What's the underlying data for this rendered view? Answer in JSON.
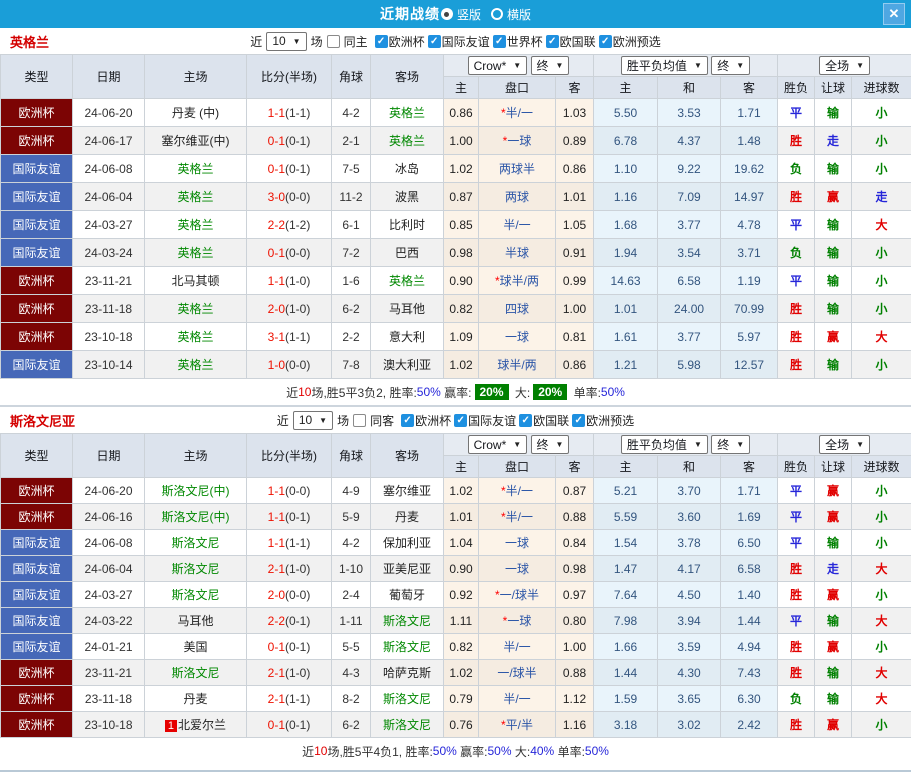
{
  "titlebar": {
    "title": "近期战绩",
    "vertical_label": "竖版",
    "horizontal_label": "横版",
    "close_glyph": "✕"
  },
  "colors": {
    "titlebar_blue": "#1a9ed8",
    "euro_cup_red": "#7c0404",
    "friendly_blue": "#4668b8",
    "featured_team_green": "#008800",
    "score_red": "#ee1100",
    "win_red": "#e10000",
    "draw_blue": "#2626d9",
    "lose_green": "#008000",
    "summary_badge_green": "#008000",
    "header_bg": "#dce3ed"
  },
  "header": {
    "cols": [
      "类型",
      "日期",
      "主场",
      "比分(半场)",
      "角球",
      "客场"
    ],
    "sub": [
      "主",
      "盘口",
      "客",
      "主",
      "和",
      "客",
      "胜负",
      "让球",
      "进球数"
    ],
    "company_select": "Crow*",
    "final_select_1": "终",
    "avg_select": "胜平负均值",
    "final_select_2": "终",
    "scope_select": "全场"
  },
  "sections": [
    {
      "team": "英格兰",
      "filter": {
        "near_label": "近",
        "count": "10",
        "games_label": "场",
        "same_label": "同主",
        "leagues": [
          "欧洲杯",
          "国际友谊",
          "世界杯",
          "欧国联",
          "欧洲预选"
        ]
      },
      "rows": [
        {
          "type": "欧洲杯",
          "date": "24-06-20",
          "home": "丹麦 (中)",
          "feat": "a",
          "badge": "",
          "score": "1-1",
          "half": "(1-1)",
          "corner": "4-2",
          "away": "英格兰",
          "hh": "0.86",
          "star": "*",
          "hname": "半/一",
          "ha": "1.03",
          "eh": "5.50",
          "ed": "3.53",
          "ea": "1.71",
          "res": "平",
          "letr": "输",
          "big": "小"
        },
        {
          "type": "欧洲杯",
          "date": "24-06-17",
          "home": "塞尔维亚(中)",
          "feat": "a",
          "badge": "",
          "score": "0-1",
          "half": "(0-1)",
          "corner": "2-1",
          "away": "英格兰",
          "hh": "1.00",
          "star": "*",
          "hname": "一球",
          "ha": "0.89",
          "eh": "6.78",
          "ed": "4.37",
          "ea": "1.48",
          "res": "胜",
          "letr": "走",
          "big": "小"
        },
        {
          "type": "国际友谊",
          "date": "24-06-08",
          "home": "英格兰",
          "feat": "h",
          "badge": "",
          "score": "0-1",
          "half": "(0-1)",
          "corner": "7-5",
          "away": "冰岛",
          "hh": "1.02",
          "star": "",
          "hname": "两球半",
          "ha": "0.86",
          "eh": "1.10",
          "ed": "9.22",
          "ea": "19.62",
          "res": "负",
          "letr": "输",
          "big": "小"
        },
        {
          "type": "国际友谊",
          "date": "24-06-04",
          "home": "英格兰",
          "feat": "h",
          "badge": "",
          "score": "3-0",
          "half": "(0-0)",
          "corner": "11-2",
          "away": "波黑",
          "hh": "0.87",
          "star": "",
          "hname": "两球",
          "ha": "1.01",
          "eh": "1.16",
          "ed": "7.09",
          "ea": "14.97",
          "res": "胜",
          "letr": "赢",
          "big": "走"
        },
        {
          "type": "国际友谊",
          "date": "24-03-27",
          "home": "英格兰",
          "feat": "h",
          "badge": "",
          "score": "2-2",
          "half": "(1-2)",
          "corner": "6-1",
          "away": "比利时",
          "hh": "0.85",
          "star": "",
          "hname": "半/一",
          "ha": "1.05",
          "eh": "1.68",
          "ed": "3.77",
          "ea": "4.78",
          "res": "平",
          "letr": "输",
          "big": "大"
        },
        {
          "type": "国际友谊",
          "date": "24-03-24",
          "home": "英格兰",
          "feat": "h",
          "badge": "",
          "score": "0-1",
          "half": "(0-0)",
          "corner": "7-2",
          "away": "巴西",
          "hh": "0.98",
          "star": "",
          "hname": "半球",
          "ha": "0.91",
          "eh": "1.94",
          "ed": "3.54",
          "ea": "3.71",
          "res": "负",
          "letr": "输",
          "big": "小"
        },
        {
          "type": "欧洲杯",
          "date": "23-11-21",
          "home": "北马其顿",
          "feat": "a",
          "badge": "",
          "score": "1-1",
          "half": "(1-0)",
          "corner": "1-6",
          "away": "英格兰",
          "hh": "0.90",
          "star": "*",
          "hname": "球半/两",
          "ha": "0.99",
          "eh": "14.63",
          "ed": "6.58",
          "ea": "1.19",
          "res": "平",
          "letr": "输",
          "big": "小"
        },
        {
          "type": "欧洲杯",
          "date": "23-11-18",
          "home": "英格兰",
          "feat": "h",
          "badge": "",
          "score": "2-0",
          "half": "(1-0)",
          "corner": "6-2",
          "away": "马耳他",
          "hh": "0.82",
          "star": "",
          "hname": "四球",
          "ha": "1.00",
          "eh": "1.01",
          "ed": "24.00",
          "ea": "70.99",
          "res": "胜",
          "letr": "输",
          "big": "小"
        },
        {
          "type": "欧洲杯",
          "date": "23-10-18",
          "home": "英格兰",
          "feat": "h",
          "badge": "",
          "score": "3-1",
          "half": "(1-1)",
          "corner": "2-2",
          "away": "意大利",
          "hh": "1.09",
          "star": "",
          "hname": "一球",
          "ha": "0.81",
          "eh": "1.61",
          "ed": "3.77",
          "ea": "5.97",
          "res": "胜",
          "letr": "赢",
          "big": "大"
        },
        {
          "type": "国际友谊",
          "date": "23-10-14",
          "home": "英格兰",
          "feat": "h",
          "badge": "",
          "score": "1-0",
          "half": "(0-0)",
          "corner": "7-8",
          "away": "澳大利亚",
          "hh": "1.02",
          "star": "",
          "hname": "球半/两",
          "ha": "0.86",
          "eh": "1.21",
          "ed": "5.98",
          "ea": "12.57",
          "res": "胜",
          "letr": "输",
          "big": "小"
        }
      ],
      "summary": {
        "parts": [
          {
            "t": "近",
            "c": ""
          },
          {
            "t": "10",
            "c": "red"
          },
          {
            "t": "场,胜5平3负2, 胜率:",
            "c": ""
          },
          {
            "t": "50%",
            "c": "blue"
          },
          {
            "t": " 赢率:",
            "c": ""
          },
          {
            "t": "20%",
            "c": "badge"
          },
          {
            "t": " 大:",
            "c": ""
          },
          {
            "t": "20%",
            "c": "badge"
          },
          {
            "t": " 单率:",
            "c": ""
          },
          {
            "t": "50%",
            "c": "blue"
          }
        ]
      }
    },
    {
      "team": "斯洛文尼亚",
      "filter": {
        "near_label": "近",
        "count": "10",
        "games_label": "场",
        "same_label": "同客",
        "leagues": [
          "欧洲杯",
          "国际友谊",
          "欧国联",
          "欧洲预选"
        ]
      },
      "rows": [
        {
          "type": "欧洲杯",
          "date": "24-06-20",
          "home": "斯洛文尼(中)",
          "feat": "h",
          "badge": "",
          "score": "1-1",
          "half": "(0-0)",
          "corner": "4-9",
          "away": "塞尔维亚",
          "hh": "1.02",
          "star": "*",
          "hname": "半/一",
          "ha": "0.87",
          "eh": "5.21",
          "ed": "3.70",
          "ea": "1.71",
          "res": "平",
          "letr": "赢",
          "big": "小"
        },
        {
          "type": "欧洲杯",
          "date": "24-06-16",
          "home": "斯洛文尼(中)",
          "feat": "h",
          "badge": "",
          "score": "1-1",
          "half": "(0-1)",
          "corner": "5-9",
          "away": "丹麦",
          "hh": "1.01",
          "star": "*",
          "hname": "半/一",
          "ha": "0.88",
          "eh": "5.59",
          "ed": "3.60",
          "ea": "1.69",
          "res": "平",
          "letr": "赢",
          "big": "小"
        },
        {
          "type": "国际友谊",
          "date": "24-06-08",
          "home": "斯洛文尼",
          "feat": "h",
          "badge": "",
          "score": "1-1",
          "half": "(1-1)",
          "corner": "4-2",
          "away": "保加利亚",
          "hh": "1.04",
          "star": "",
          "hname": "一球",
          "ha": "0.84",
          "eh": "1.54",
          "ed": "3.78",
          "ea": "6.50",
          "res": "平",
          "letr": "输",
          "big": "小"
        },
        {
          "type": "国际友谊",
          "date": "24-06-04",
          "home": "斯洛文尼",
          "feat": "h",
          "badge": "",
          "score": "2-1",
          "half": "(1-0)",
          "corner": "1-10",
          "away": "亚美尼亚",
          "hh": "0.90",
          "star": "",
          "hname": "一球",
          "ha": "0.98",
          "eh": "1.47",
          "ed": "4.17",
          "ea": "6.58",
          "res": "胜",
          "letr": "走",
          "big": "大"
        },
        {
          "type": "国际友谊",
          "date": "24-03-27",
          "home": "斯洛文尼",
          "feat": "h",
          "badge": "",
          "score": "2-0",
          "half": "(0-0)",
          "corner": "2-4",
          "away": "葡萄牙",
          "hh": "0.92",
          "star": "*",
          "hname": "一/球半",
          "ha": "0.97",
          "eh": "7.64",
          "ed": "4.50",
          "ea": "1.40",
          "res": "胜",
          "letr": "赢",
          "big": "小"
        },
        {
          "type": "国际友谊",
          "date": "24-03-22",
          "home": "马耳他",
          "feat": "a",
          "badge": "",
          "score": "2-2",
          "half": "(0-1)",
          "corner": "1-11",
          "away": "斯洛文尼",
          "hh": "1.11",
          "star": "*",
          "hname": "一球",
          "ha": "0.80",
          "eh": "7.98",
          "ed": "3.94",
          "ea": "1.44",
          "res": "平",
          "letr": "输",
          "big": "大"
        },
        {
          "type": "国际友谊",
          "date": "24-01-21",
          "home": "美国",
          "feat": "a",
          "badge": "",
          "score": "0-1",
          "half": "(0-1)",
          "corner": "5-5",
          "away": "斯洛文尼",
          "hh": "0.82",
          "star": "",
          "hname": "半/一",
          "ha": "1.00",
          "eh": "1.66",
          "ed": "3.59",
          "ea": "4.94",
          "res": "胜",
          "letr": "赢",
          "big": "小"
        },
        {
          "type": "欧洲杯",
          "date": "23-11-21",
          "home": "斯洛文尼",
          "feat": "h",
          "badge": "",
          "score": "2-1",
          "half": "(1-0)",
          "corner": "4-3",
          "away": "哈萨克斯",
          "hh": "1.02",
          "star": "",
          "hname": "一/球半",
          "ha": "0.88",
          "eh": "1.44",
          "ed": "4.30",
          "ea": "7.43",
          "res": "胜",
          "letr": "输",
          "big": "大"
        },
        {
          "type": "欧洲杯",
          "date": "23-11-18",
          "home": "丹麦",
          "feat": "a",
          "badge": "",
          "score": "2-1",
          "half": "(1-1)",
          "corner": "8-2",
          "away": "斯洛文尼",
          "hh": "0.79",
          "star": "",
          "hname": "半/一",
          "ha": "1.12",
          "eh": "1.59",
          "ed": "3.65",
          "ea": "6.30",
          "res": "负",
          "letr": "输",
          "big": "大"
        },
        {
          "type": "欧洲杯",
          "date": "23-10-18",
          "home": "北爱尔兰",
          "feat": "a",
          "badge": "1",
          "score": "0-1",
          "half": "(0-1)",
          "corner": "6-2",
          "away": "斯洛文尼",
          "hh": "0.76",
          "star": "*",
          "hname": "平/半",
          "ha": "1.16",
          "eh": "3.18",
          "ed": "3.02",
          "ea": "2.42",
          "res": "胜",
          "letr": "赢",
          "big": "小"
        }
      ],
      "summary": {
        "parts": [
          {
            "t": "近",
            "c": ""
          },
          {
            "t": "10",
            "c": "red"
          },
          {
            "t": "场,胜5平4负1, 胜率:",
            "c": ""
          },
          {
            "t": "50%",
            "c": "blue"
          },
          {
            "t": " 赢率:",
            "c": ""
          },
          {
            "t": "50%",
            "c": "blue"
          },
          {
            "t": " 大:",
            "c": ""
          },
          {
            "t": "40%",
            "c": "blue"
          },
          {
            "t": " 单率:",
            "c": ""
          },
          {
            "t": "50%",
            "c": "blue"
          }
        ]
      }
    }
  ]
}
